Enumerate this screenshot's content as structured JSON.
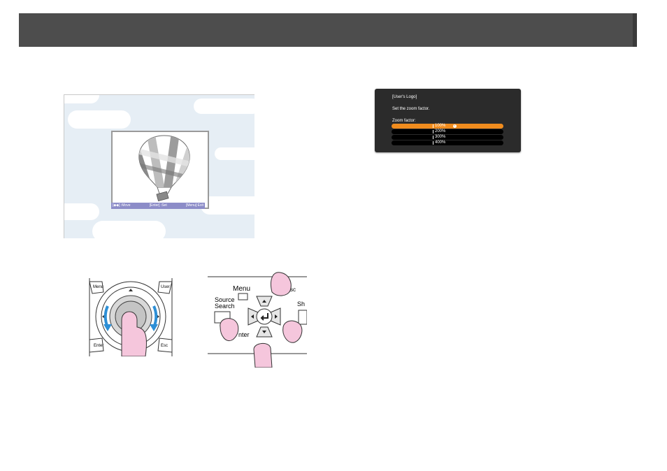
{
  "capture_hint": {
    "move": "[◆◆] :Move",
    "set": "[Enter] :Set",
    "exit": "[Menu]:Exit"
  },
  "zoom_menu": {
    "title": "[User's Logo]",
    "instruction": "Set the zoom factor.",
    "label": "Zoom factor:",
    "options": [
      {
        "label": "100%",
        "selected": true
      },
      {
        "label": "200%",
        "selected": false
      },
      {
        "label": "300%",
        "selected": false
      },
      {
        "label": "400%",
        "selected": false
      }
    ]
  },
  "remote": {
    "menu_label": "Menu",
    "user_label": "User",
    "enter_label": "Enter",
    "esc_label": "Esc"
  },
  "control_panel": {
    "menu_label": "Menu",
    "source_label_1": "Source",
    "source_label_2": "Search",
    "enter_partial": "nter",
    "esc_partial": "sc",
    "sh_partial": "Sh"
  },
  "colors": {
    "header": "#4d4d4d",
    "menu_bg": "#2b2b2b",
    "selected_option": "#f08c1e",
    "hint_bar": "#8c8cc8",
    "finger": "#f5c6dc",
    "arrow": "#2d8fd6"
  }
}
